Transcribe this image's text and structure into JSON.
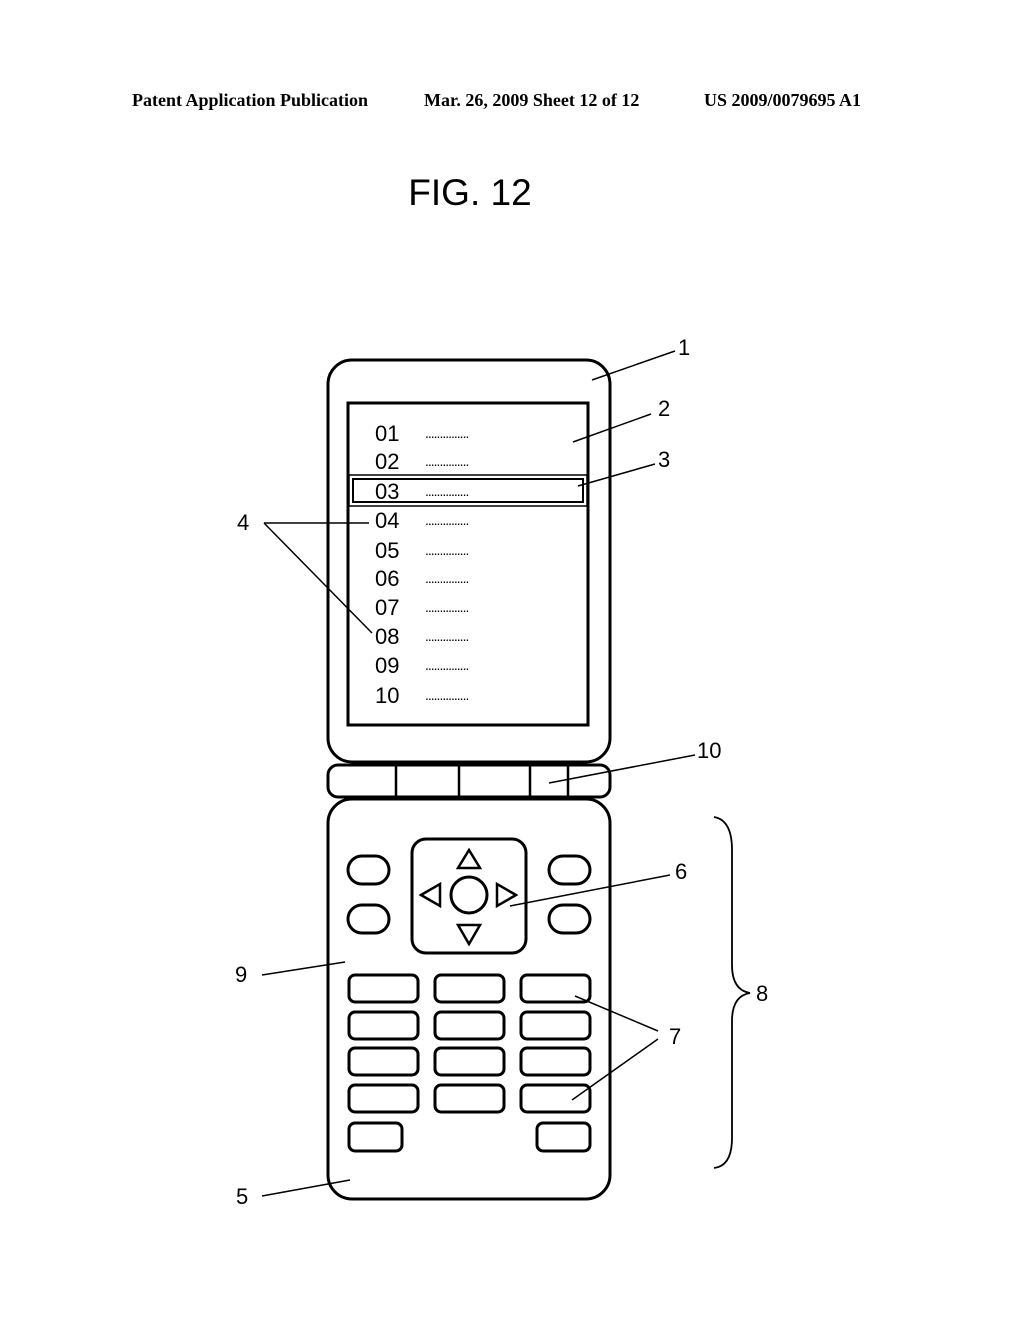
{
  "header": {
    "publication": "Patent Application Publication",
    "date_sheet": "Mar. 26, 2009  Sheet 12 of 12",
    "patent_number": "US 2009/0079695 A1"
  },
  "figure": {
    "title": "FIG. 12"
  },
  "screen_list": {
    "items": [
      {
        "number": "01",
        "text": "..............."
      },
      {
        "number": "02",
        "text": "..............."
      },
      {
        "number": "03",
        "text": "..............."
      },
      {
        "number": "04",
        "text": "..............."
      },
      {
        "number": "05",
        "text": "..............."
      },
      {
        "number": "06",
        "text": "..............."
      },
      {
        "number": "07",
        "text": "..............."
      },
      {
        "number": "08",
        "text": "..............."
      },
      {
        "number": "09",
        "text": "..............."
      },
      {
        "number": "10",
        "text": "..............."
      }
    ],
    "selected_index": 2
  },
  "reference_labels": {
    "upper_housing": "1",
    "display": "2",
    "cursor": "3",
    "list_items": "4",
    "lower_housing": "5",
    "cross_key": "6",
    "keys": "7",
    "operation_unit": "8",
    "key_panel": "9",
    "hinge": "10"
  }
}
